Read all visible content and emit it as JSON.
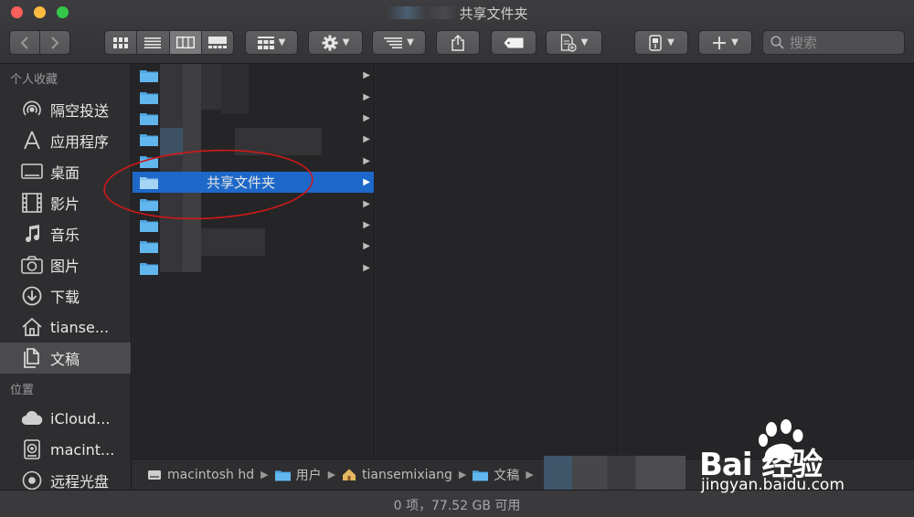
{
  "window": {
    "title": "共享文件夹"
  },
  "toolbar": {
    "search_placeholder": "搜索"
  },
  "sidebar": {
    "favorites_header": "个人收藏",
    "favorites": [
      {
        "label": "隔空投送",
        "icon": "airdrop-icon"
      },
      {
        "label": "应用程序",
        "icon": "applications-icon"
      },
      {
        "label": "桌面",
        "icon": "desktop-icon"
      },
      {
        "label": "影片",
        "icon": "movies-icon"
      },
      {
        "label": "音乐",
        "icon": "music-icon"
      },
      {
        "label": "图片",
        "icon": "pictures-icon"
      },
      {
        "label": "下载",
        "icon": "downloads-icon"
      },
      {
        "label": "tianse...",
        "icon": "home-icon"
      },
      {
        "label": "文稿",
        "icon": "documents-icon",
        "selected": true
      }
    ],
    "locations_header": "位置",
    "locations": [
      {
        "label": "iCloud...",
        "icon": "icloud-icon"
      },
      {
        "label": "macint...",
        "icon": "harddisk-icon"
      },
      {
        "label": "远程光盘",
        "icon": "remote-disc-icon"
      }
    ]
  },
  "column1": {
    "selected_label": "共享文件夹"
  },
  "pathbar": {
    "items": [
      {
        "label": "macintosh hd",
        "icon": "harddisk-icon"
      },
      {
        "label": "用户",
        "icon": "folder-icon"
      },
      {
        "label": "tiansemixiang",
        "icon": "home-icon"
      },
      {
        "label": "文稿",
        "icon": "folder-icon"
      }
    ]
  },
  "statusbar": {
    "text": "0 项，77.52 GB 可用"
  },
  "watermark": {
    "brand": "Bai  经验",
    "url": "jingyan.baidu.com"
  },
  "colors": {
    "selection": "#1e68c9",
    "folder": "#4ea6e3",
    "annotation": "#d01818"
  }
}
